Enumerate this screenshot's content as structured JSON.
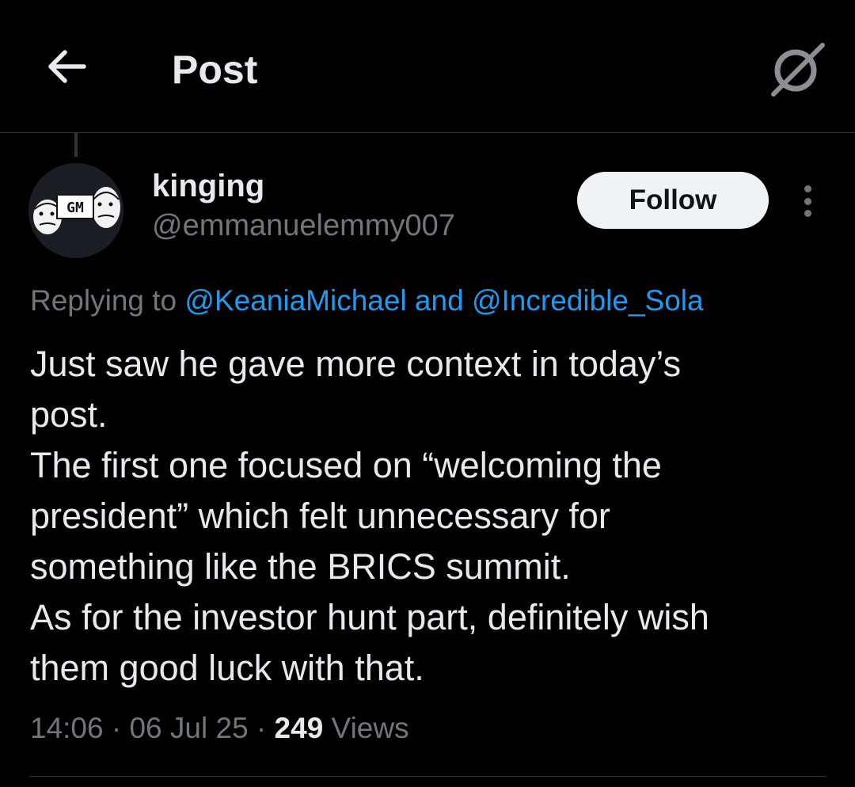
{
  "header": {
    "title": "Post",
    "back_icon": "arrow-left-icon",
    "grok_icon": "grok-icon"
  },
  "author": {
    "name": "kinging",
    "handle": "@emmanuelemmy007",
    "avatar_text": "GM",
    "follow_label": "Follow"
  },
  "reply": {
    "prefix": "Replying to ",
    "mention_1": "@KeaniaMichael",
    "conjunction": " and ",
    "mention_2": "@Incredible_Sola"
  },
  "tweet": {
    "lines": [
      "Just saw he gave more context in today’s",
      "post.",
      "The first one focused on “welcoming the",
      "president” which felt unnecessary for",
      "something like the BRICS summit.",
      "As for the investor hunt part, definitely wish",
      "them good luck with that."
    ]
  },
  "meta": {
    "time": "14:06",
    "sep1": " · ",
    "date": "06 Jul 25",
    "sep2": " · ",
    "views_count": "249",
    "views_label": " Views"
  },
  "colors": {
    "background": "#000000",
    "text_primary": "#e7e9ea",
    "text_secondary": "#71767b",
    "link": "#1d9bf0",
    "follow_bg": "#eff3f4"
  }
}
